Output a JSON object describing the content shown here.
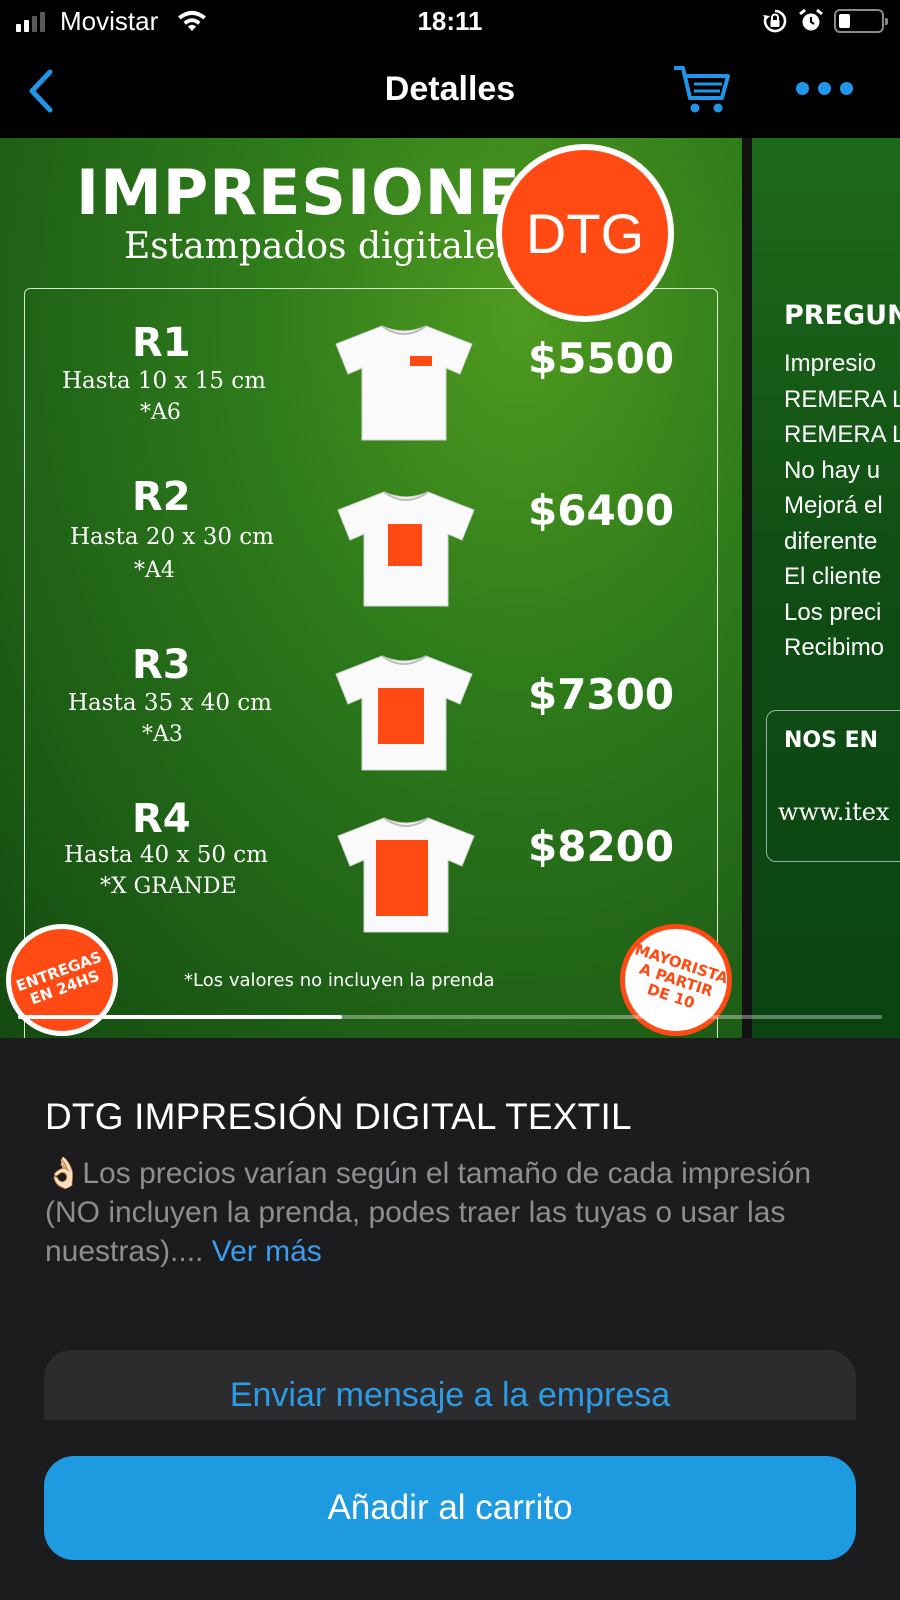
{
  "status_bar": {
    "carrier": "Movistar",
    "time": "18:11",
    "battery_level": 0.2
  },
  "nav": {
    "title": "Detalles",
    "back_icon": "chevron-left-icon",
    "cart_icon": "cart-icon",
    "more_icon": "more-dots-icon",
    "accent": "#2196e8"
  },
  "gallery": {
    "progress": 0.375,
    "slide_1": {
      "title": "IMPRESIONES",
      "subtitle": "Estampados digitales",
      "badge": "DTG",
      "rows": [
        {
          "code": "R1",
          "size": "Hasta 10 x 15 cm",
          "format": "*A6",
          "price": "$5500",
          "print_area": 0.15
        },
        {
          "code": "R2",
          "size": "Hasta 20 x 30 cm",
          "format": "*A4",
          "price": "$6400",
          "print_area": 0.4
        },
        {
          "code": "R3",
          "size": "Hasta 35 x 40 cm",
          "format": "*A3",
          "price": "$7300",
          "print_area": 0.6
        },
        {
          "code": "R4",
          "size": "Hasta 40 x 50 cm",
          "format": "*X GRANDE",
          "price": "$8200",
          "print_area": 0.8
        }
      ],
      "badge_delivery": "ENTREGAS EN 24HS",
      "badge_wholesale": "MAYORISTA A PARTIR DE 10",
      "disclaimer": "*Los valores no incluyen la prenda"
    },
    "slide_2": {
      "heading": "PREGUN",
      "lines": [
        "Impresio",
        "REMERA L",
        "REMERA L",
        "No hay u",
        "Mejorá el",
        "diferente",
        "El cliente",
        "Los preci",
        "Recibimo"
      ],
      "box_title": "NOS EN",
      "box_url": "www.itex"
    }
  },
  "product": {
    "title": "DTG IMPRESIÓN DIGITAL TEXTIL",
    "emoji": "👌🏻",
    "description": "Los precios varían según el tamaño de cada impresión (NO incluyen la prenda, podes traer las tuyas o usar las nuestras)....",
    "see_more": "Ver más",
    "message_button": "Enviar mensaje a la empresa",
    "add_to_cart_button": "Añadir al carrito"
  }
}
